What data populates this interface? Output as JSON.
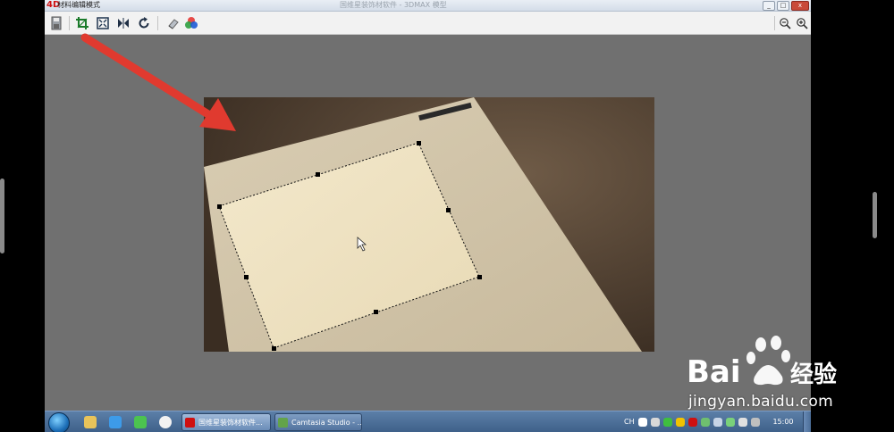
{
  "window": {
    "app_logo": "4D",
    "title": "材料编辑模式",
    "center_title": "国维星装饰材软件 - 3DMAX 模型",
    "buttons": {
      "minimize": "_",
      "maximize": "□",
      "close": "x"
    }
  },
  "toolbar": {
    "items": [
      {
        "name": "save-icon",
        "tooltip": ""
      },
      {
        "name": "crop-icon",
        "tooltip": ""
      },
      {
        "name": "fit-frame-icon",
        "tooltip": ""
      },
      {
        "name": "mirror-icon",
        "tooltip": ""
      },
      {
        "name": "rotate-icon",
        "tooltip": ""
      },
      {
        "name": "eraser-icon",
        "tooltip": ""
      },
      {
        "name": "color-adjust-icon",
        "tooltip": ""
      },
      {
        "name": "zoom-out-icon",
        "tooltip": ""
      },
      {
        "name": "zoom-in-icon",
        "tooltip": ""
      }
    ]
  },
  "taskbar": {
    "quick_launch": [
      "explorer-icon",
      "ie-icon",
      "wechat-icon",
      "qq-icon"
    ],
    "tasks": [
      {
        "label": "国维星装饰材软件...",
        "active": true
      },
      {
        "label": "Camtasia Studio - ...",
        "active": false
      }
    ],
    "ime_label": "CH",
    "clock": "15:00"
  },
  "watermark": {
    "brand": "Bai",
    "brand_suffix": "经验",
    "url": "jingyan.baidu.com"
  },
  "colors": {
    "canvas_bg": "#707070",
    "arrow_red": "#e03a2f",
    "tile": "#eee2c4",
    "floor": "#5b4a3a"
  }
}
